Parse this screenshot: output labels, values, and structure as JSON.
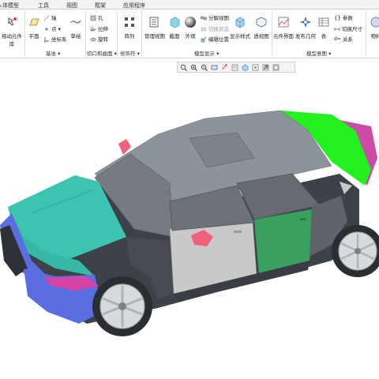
{
  "tabs": [
    "人体模型",
    "工具",
    "视图",
    "框架",
    "应用程序"
  ],
  "ribbon": {
    "drag_component": "拖动元件库",
    "plane": "平面",
    "axis": "轴",
    "point": "点",
    "coord_sys": "坐标系",
    "sketch": "草绘",
    "hole": "孔",
    "extrude": "拉伸",
    "revolve": "旋转",
    "pattern": "阵列",
    "manage_views": "管理视图",
    "section": "截面",
    "appearance": "外观",
    "explode_view": "分解视图",
    "toggle_status": "切换状态",
    "edit_position": "编辑位置",
    "display_style": "显示样式",
    "perspective": "透视图",
    "component_interface": "元件界面",
    "publish_geometry": "发布几何",
    "table": "表",
    "relations": "关系",
    "parameters": "参数",
    "switch_dimensions": "切换尺寸",
    "physics": "物料",
    "groups": {
      "datum": "基准 ▾",
      "cut_surface": "切口和曲面 ▾",
      "modifiers": "修饰符 ▾",
      "model_display": "模型显示 ▾",
      "model_intent": "模型意图 ▾"
    }
  },
  "view_toolbar": {
    "icons": [
      "zoom-fit-icon",
      "zoom-in-icon",
      "zoom-out-icon",
      "repaint-icon",
      "orient-icon",
      "saved-views-icon",
      "display-style-icon",
      "datum-display-icon",
      "spin-center-icon",
      "annotation-display-icon"
    ]
  },
  "colors": {
    "body_gray": "#8d939a",
    "roof_gray": "#9ca3aa",
    "hood_teal": "#3cc4b0",
    "bumper_blue": "#5a6ee0",
    "trunk_green": "#23f020",
    "rear_magenta": "#cc4aa8",
    "door_green": "#3aa05f",
    "door_silver": "#c9c9c9",
    "fender_dark": "#484c52",
    "mirror_pink": "#f0607a",
    "headlight_magenta": "#d642a6"
  }
}
